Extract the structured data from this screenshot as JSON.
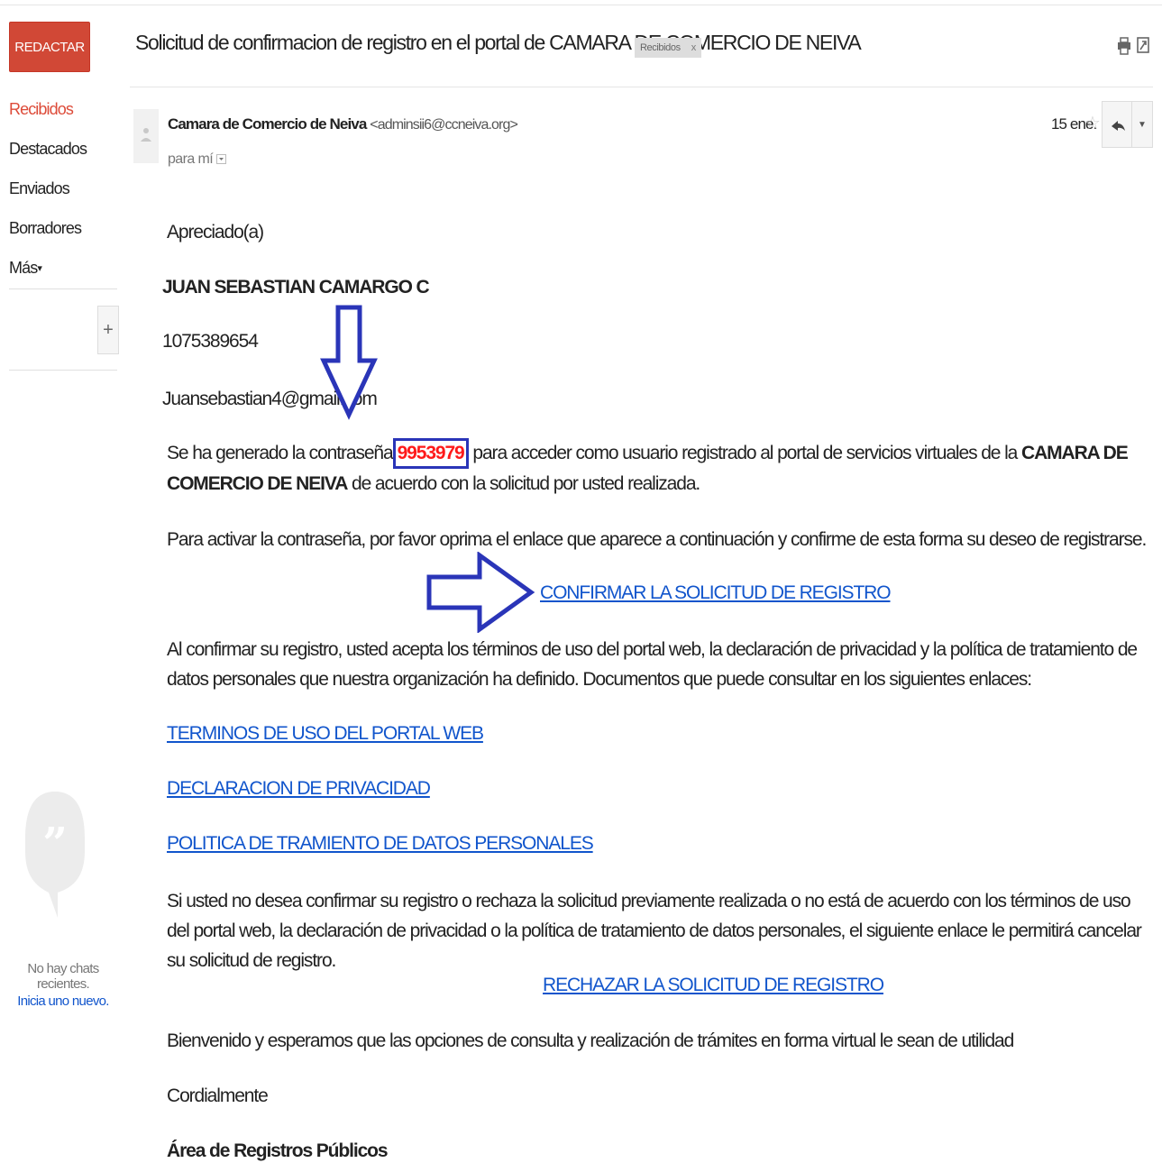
{
  "sidebar": {
    "compose_label": "REDACTAR",
    "nav": [
      {
        "label": "Recibidos"
      },
      {
        "label": "Destacados"
      },
      {
        "label": "Enviados"
      },
      {
        "label": "Borradores"
      },
      {
        "label": "Más"
      }
    ],
    "hangouts_add": "+",
    "chat_empty": "No hay chats recientes.",
    "chat_start": "Inicia uno nuevo."
  },
  "thread": {
    "subject": "Solicitud de confirmacion de registro en el portal de CAMARA DE COMERCIO DE NEIVA",
    "label_chip": "Recibidos",
    "label_chip_close": "x"
  },
  "message": {
    "sender_name": "Camara de Comercio de Neiva",
    "sender_email": "<adminsii6@ccneiva.org>",
    "to": "para mí",
    "date": "15 ene.",
    "star": "☆"
  },
  "body": {
    "greeting": "Apreciado(a)",
    "name": "JUAN SEBASTIAN CAMARGO C",
    "id_number": "1075389654",
    "email": "Juansebastian4@gmail.com",
    "p1_a": "Se ha generado la contraseña",
    "password": "9953979",
    "p1_b": "para acceder como usuario registrado al portal de servicios virtuales de la",
    "p1_org": "CAMARA DE COMERCIO DE NEIVA",
    "p1_c": "de acuerdo con la solicitud por usted realizada.",
    "p2": "Para activar la contraseña, por favor oprima el enlace que aparece a continuación y confirme de esta forma su deseo de registrarse.",
    "confirm_link": "CONFIRMAR LA SOLICITUD DE REGISTRO",
    "p3": "Al confirmar su registro, usted acepta los términos de uso del portal web, la declaración de privacidad y la política de tratamiento de datos personales que nuestra organización ha definido. Documentos que puede consultar en los siguientes enlaces:",
    "link_terms": "TERMINOS DE USO DEL PORTAL WEB",
    "link_privacy": "DECLARACION DE PRIVACIDAD",
    "link_policy": "POLITICA DE TRAMIENTO DE DATOS PERSONALES",
    "p4": "Si usted no desea confirmar su registro o rechaza la solicitud previamente realizada o no está de acuerdo con los términos de uso del portal web, la declaración de privacidad o la política de tratamiento de datos personales, el siguiente enlace le permitirá cancelar su solicitud de registro.",
    "reject_link": "RECHAZAR LA SOLICITUD DE REGISTRO",
    "p5": "Bienvenido y esperamos que las opciones de consulta y realización de trámites en forma virtual le sean de utilidad",
    "closing": "Cordialmente",
    "signature": "Área de Registros Públicos"
  },
  "colors": {
    "compose": "#d14836",
    "active_nav": "#dd4b39",
    "link": "#1155cc",
    "annotation": "#2a35b8",
    "password": "#ff1a1a"
  }
}
